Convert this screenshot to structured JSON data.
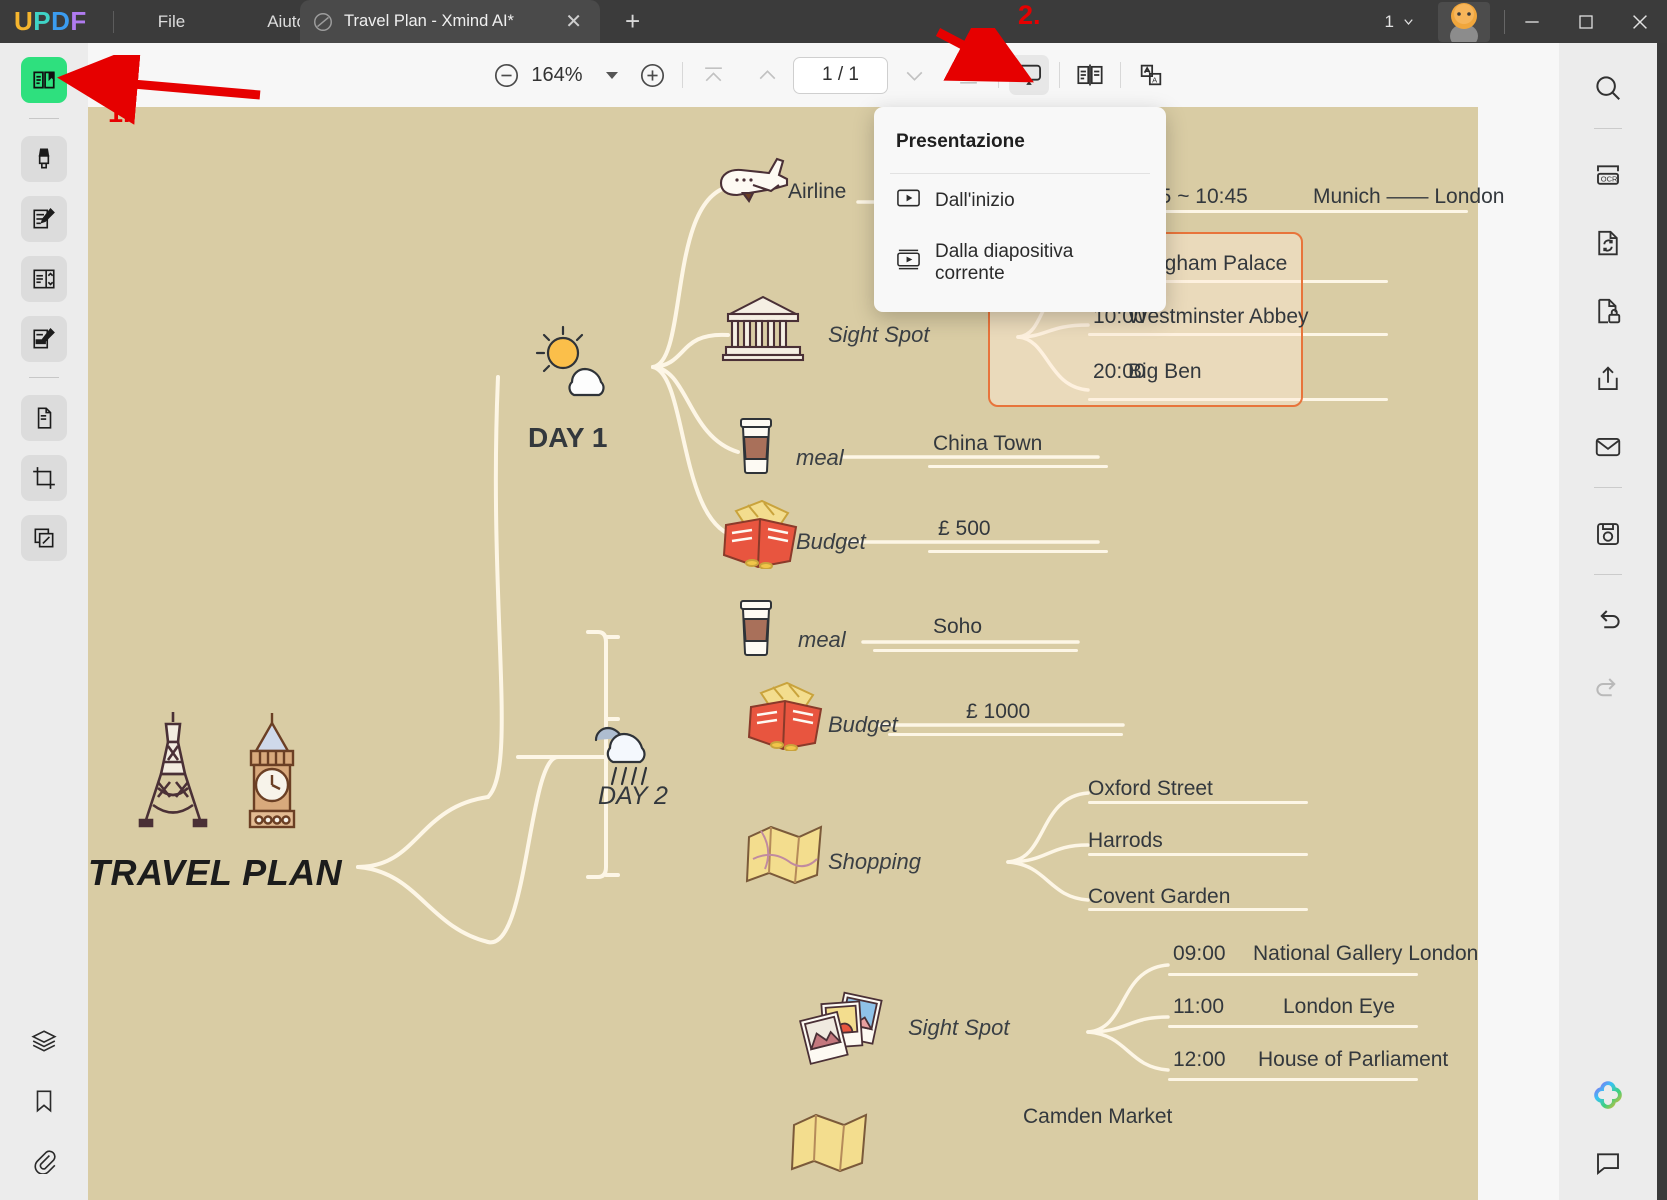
{
  "titlebar": {
    "logo": "UPDF",
    "menus": [
      "File",
      "Aiuto"
    ],
    "tab_title": "Travel Plan - Xmind AI*",
    "tab_close": "✕",
    "new_tab": "+",
    "window_count": "1",
    "minimize": "minimize-icon",
    "maximize": "maximize-icon",
    "close": "close-icon"
  },
  "left_rail": {
    "items": [
      {
        "name": "reader-view",
        "active": true
      },
      {
        "name": "highlighter-tool",
        "active": false
      },
      {
        "name": "edit-text-tool",
        "active": false
      },
      {
        "name": "form-fields-tool",
        "active": false
      },
      {
        "name": "annotate-tool",
        "active": false
      },
      {
        "name": "organize-pages-tool",
        "active": false
      },
      {
        "name": "crop-tool",
        "active": false
      },
      {
        "name": "batch-tool",
        "active": false
      }
    ],
    "bottom": [
      {
        "name": "layers"
      },
      {
        "name": "bookmarks"
      },
      {
        "name": "attachments"
      }
    ]
  },
  "toolbar": {
    "zoom_out": "zoom-out-icon",
    "zoom_level": "164%",
    "zoom_dropdown": "chevron-down-icon",
    "zoom_in": "zoom-in-icon",
    "first_page": "first-page-icon",
    "prev_page": "previous-page-icon",
    "page_indicator": "1 / 1",
    "next_page": "next-page-icon",
    "last_page": "last-page-icon",
    "presentation": "presentation-icon",
    "page_layout": "dual-page-layout-icon",
    "translate": "translate-icon"
  },
  "right_rail": {
    "items": [
      {
        "name": "search"
      },
      {
        "name": "ocr"
      },
      {
        "name": "convert-pdf"
      },
      {
        "name": "protect-document"
      },
      {
        "name": "share"
      },
      {
        "name": "email"
      },
      {
        "name": "save-as-image"
      },
      {
        "name": "undo"
      },
      {
        "name": "redo"
      }
    ],
    "bottom": [
      {
        "name": "ai-assistant"
      },
      {
        "name": "comments"
      }
    ]
  },
  "dropdown": {
    "title": "Presentazione",
    "items": [
      {
        "label": "Dall'inizio",
        "icon": "play-from-start-icon"
      },
      {
        "label": "Dalla diapositiva corrente",
        "icon": "play-from-current-slide-icon"
      }
    ]
  },
  "annotations": {
    "step_one": "1.",
    "step_two": "2.",
    "arrow_color": "#e60000"
  },
  "mindmap": {
    "central_title": "TRAVEL PLAN",
    "central_icons": [
      "eiffel-tower-icon",
      "big-ben-icon"
    ],
    "days": [
      {
        "label": "DAY 1",
        "weather_icon": "sun-cloud-icon",
        "branches": [
          {
            "label": "Airline",
            "icon": "airplane-icon",
            "leaves": [
              {
                "time": "45 ~ 10:45",
                "text": "Munich —— London"
              }
            ]
          },
          {
            "label": "Sight Spot",
            "icon": "monument-icon",
            "leaves": [
              {
                "time": "",
                "text": "ngham Palace"
              },
              {
                "time": "10:00",
                "text": "Westminster Abbey"
              },
              {
                "time": "20:00",
                "text": "Big Ben"
              }
            ]
          },
          {
            "label": "meal",
            "icon": "coffee-cup-icon",
            "leaves": [
              {
                "time": "",
                "text": "China Town"
              }
            ]
          },
          {
            "label": "Budget",
            "icon": "wallet-icon",
            "leaves": [
              {
                "time": "",
                "text": "£ 500"
              }
            ]
          }
        ]
      },
      {
        "label": "DAY 2",
        "weather_icon": "rain-cloud-icon",
        "branches": [
          {
            "label": "meal",
            "icon": "coffee-cup-icon",
            "leaves": [
              {
                "time": "",
                "text": "Soho"
              }
            ]
          },
          {
            "label": "Budget",
            "icon": "wallet-icon",
            "leaves": [
              {
                "time": "",
                "text": "£ 1000"
              }
            ]
          },
          {
            "label": "Shopping",
            "icon": "map-icon",
            "leaves": [
              {
                "time": "",
                "text": "Oxford Street"
              },
              {
                "time": "",
                "text": "Harrods"
              },
              {
                "time": "",
                "text": "Covent Garden"
              }
            ]
          },
          {
            "label": "Sight Spot",
            "icon": "photos-icon",
            "leaves": [
              {
                "time": "09:00",
                "text": "National Gallery London"
              },
              {
                "time": "11:00",
                "text": "London Eye"
              },
              {
                "time": "12:00",
                "text": "House of Parliament"
              }
            ]
          },
          {
            "label": "Shopping",
            "icon": "map-icon",
            "leaves": [
              {
                "time": "",
                "text": "Camden Market"
              }
            ]
          }
        ]
      }
    ]
  },
  "nodes": {
    "airline_label": "Airline",
    "airline_time": "45 ~ 10:45",
    "airline_route": "Munich —— London",
    "d1_sight_label": "Sight Spot",
    "d1_sight_1": "ngham Palace",
    "d1_sight_2_time": "10:00",
    "d1_sight_2": "Westminster Abbey",
    "d1_sight_3_time": "20:00",
    "d1_sight_3": "Big Ben",
    "d1_meal_label": "meal",
    "d1_meal_val": "China Town",
    "d1_budget_label": "Budget",
    "d1_budget_val": "£ 500",
    "d2_meal_label": "meal",
    "d2_meal_val": "Soho",
    "d2_budget_label": "Budget",
    "d2_budget_val": "£ 1000",
    "d2_shop_label": "Shopping",
    "d2_shop_1": "Oxford Street",
    "d2_shop_2": "Harrods",
    "d2_shop_3": "Covent Garden",
    "d2_sight_label": "Sight Spot",
    "d2_sight_1_time": "09:00",
    "d2_sight_1": "National Gallery London",
    "d2_sight_2_time": "11:00",
    "d2_sight_2": "London Eye",
    "d2_sight_3_time": "12:00",
    "d2_sight_3": "House of Parliament",
    "d2_shop2_val": "Camden Market",
    "day1": "DAY 1",
    "day2": "DAY 2",
    "central": "TRAVEL PLAN"
  },
  "colors": {
    "canvas_bg": "#d9cca4",
    "accent_green": "#2ee07e",
    "annotation_red": "#e60000",
    "highlight_orange": "#e8743b",
    "line_white": "#fdf6e6"
  }
}
